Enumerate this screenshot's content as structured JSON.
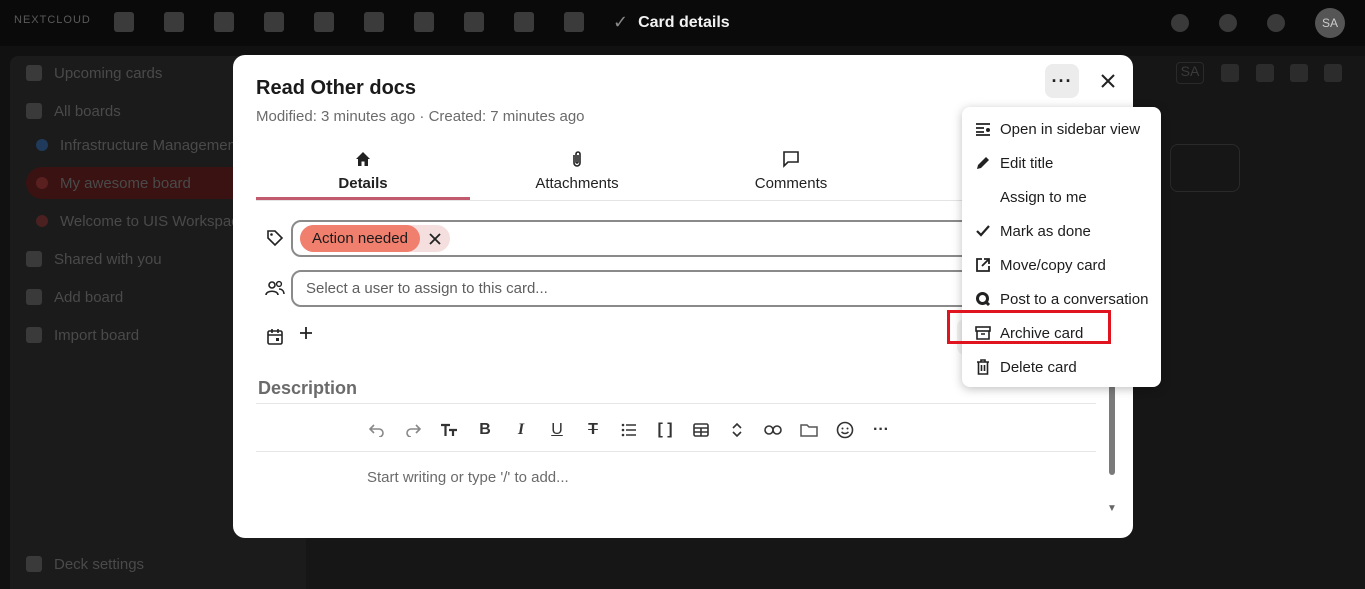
{
  "topbar": {
    "brand": "NEXTCLOUD",
    "title": "Card details",
    "avatar_initials": "SA"
  },
  "sidebar": {
    "items": [
      {
        "label": "Upcoming cards"
      },
      {
        "label": "All boards"
      },
      {
        "label": "Infrastructure Management"
      },
      {
        "label": "My awesome board"
      },
      {
        "label": "Welcome to UIS Workspace"
      },
      {
        "label": "Shared with you"
      },
      {
        "label": "Add board"
      },
      {
        "label": "Import board"
      }
    ],
    "settings_label": "Deck settings"
  },
  "board": {
    "user_badge": "SA"
  },
  "card": {
    "title": "Read Other docs",
    "meta": "Modified: 3 minutes ago · Created: 7 minutes ago",
    "tabs": [
      {
        "label": "Details"
      },
      {
        "label": "Attachments"
      },
      {
        "label": "Comments"
      }
    ],
    "tag": {
      "label": "Action needed",
      "color": "#f07f6e"
    },
    "assign_placeholder": "Select a user to assign to this card...",
    "description_label": "Description",
    "editor_placeholder": "Start writing or type '/' to add...",
    "accent_color": "#c25a6e"
  },
  "menu": {
    "items": [
      {
        "label": "Open in sidebar view",
        "icon": "sidebar-view-icon"
      },
      {
        "label": "Edit title",
        "icon": "pencil-icon"
      },
      {
        "label": "Assign to me",
        "icon": "none"
      },
      {
        "label": "Mark as done",
        "icon": "check-icon"
      },
      {
        "label": "Move/copy card",
        "icon": "external-link-icon"
      },
      {
        "label": "Post to a conversation",
        "icon": "talk-icon"
      },
      {
        "label": "Archive card",
        "icon": "archive-icon"
      },
      {
        "label": "Delete card",
        "icon": "trash-icon"
      }
    ],
    "highlight_color": "#e0141e"
  }
}
